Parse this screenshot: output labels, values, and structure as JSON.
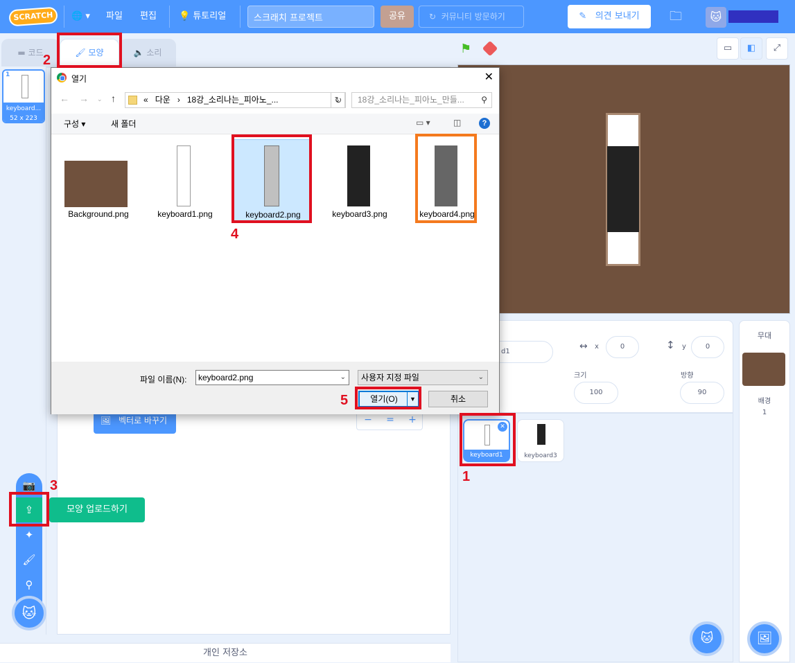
{
  "menubar": {
    "logo": "SCRATCH",
    "file_menu": "파일",
    "edit_menu": "편집",
    "tutorials": "튜토리얼",
    "project_title": "스크래치 프로젝트",
    "share": "공유",
    "community": "커뮤니티 방문하기",
    "feedback": "의견 보내기"
  },
  "tabs": {
    "code": "코드",
    "costumes": "모양",
    "sounds": "소리"
  },
  "costume": {
    "index": "1",
    "name": "keyboard...",
    "size": "52 x 223"
  },
  "paint": {
    "vector_button": "벡터로 바꾸기",
    "zoom_out": "−",
    "zoom_reset": "=",
    "zoom_in": "+"
  },
  "save_bar": "개인 저장소",
  "add_menu": {
    "upload_tooltip": "모양 업로드하기"
  },
  "sprite_info": {
    "name_partial": "d1",
    "x_label": "x",
    "x_value": "0",
    "y_label": "y",
    "y_value": "0",
    "size_label": "크기",
    "size_value": "100",
    "direction_label": "방향",
    "direction_value": "90"
  },
  "sprites": [
    {
      "name": "keyboard1",
      "selected": true
    },
    {
      "name": "keyboard3",
      "selected": false
    }
  ],
  "stage_pane": {
    "title": "무대",
    "backdrop_label": "배경",
    "backdrop_count": "1"
  },
  "dialog": {
    "title": "열기",
    "path_prefix": "«",
    "path_segment1": "다운",
    "path_segment2": "18강_소리나는_피아노_...",
    "search_placeholder": "18강_소리나는_피아노_만들...",
    "organize": "구성 ▾",
    "new_folder": "새 폴더",
    "files": [
      {
        "name": "Background.png"
      },
      {
        "name": "keyboard1.png"
      },
      {
        "name": "keyboard2.png"
      },
      {
        "name": "keyboard3.png"
      },
      {
        "name": "keyboard4.png"
      }
    ],
    "filename_label": "파일 이름(N):",
    "filename_value": "keyboard2.png",
    "filetype": "사용자 지정 파일",
    "open_button": "열기(O)",
    "cancel_button": "취소"
  },
  "annotations": {
    "n1": "1",
    "n2": "2",
    "n3": "3",
    "n4": "4",
    "n5": "5"
  },
  "colors": {
    "scratch_blue": "#4c97ff",
    "highlight_red": "#e01020",
    "highlight_orange": "#f47a1e",
    "backdrop_brown": "#70513d"
  }
}
